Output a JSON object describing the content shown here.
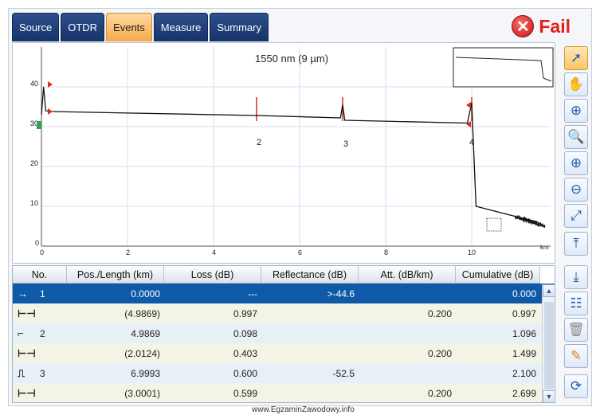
{
  "tabs": [
    {
      "label": "Source",
      "active": false
    },
    {
      "label": "OTDR",
      "active": false
    },
    {
      "label": "Events",
      "active": true
    },
    {
      "label": "Measure",
      "active": false
    },
    {
      "label": "Summary",
      "active": false
    }
  ],
  "status": {
    "label": "Fail",
    "color": "#e2211b"
  },
  "chart": {
    "wavelength_label": "1550 nm (9 µm)",
    "x_unit": "km",
    "y_ticks": [
      "40",
      "30",
      "20",
      "10",
      "0"
    ],
    "x_ticks": [
      "0",
      "2",
      "4",
      "6",
      "8",
      "10"
    ],
    "event_labels": [
      "2",
      "3",
      "4"
    ]
  },
  "chart_data": {
    "type": "line",
    "title": "1550 nm (9 µm)",
    "xlabel": "km",
    "ylabel": "",
    "xlim": [
      0,
      11.7
    ],
    "ylim": [
      0,
      50
    ],
    "grid": true,
    "series": [
      {
        "values": [
          [
            0,
            33
          ],
          [
            0.05,
            40
          ],
          [
            0.1,
            34
          ],
          [
            0.2,
            33.8
          ],
          [
            5.0,
            32.8
          ],
          [
            6.95,
            32.2
          ],
          [
            7.0,
            35.5
          ],
          [
            7.05,
            31.6
          ],
          [
            9.9,
            30.9
          ],
          [
            10.0,
            36
          ],
          [
            10.1,
            10
          ],
          [
            11.0,
            7.5
          ],
          [
            11.5,
            6.2
          ],
          [
            11.7,
            4.8
          ]
        ]
      }
    ],
    "events": [
      {
        "label": "2",
        "x": 5.0
      },
      {
        "label": "3",
        "x": 7.0
      },
      {
        "label": "4",
        "x": 10.0
      }
    ]
  },
  "tools": [
    "cursor-icon",
    "hand-icon",
    "zoom-area-icon",
    "zoom-1to1-icon",
    "zoom-in-icon",
    "zoom-out-icon",
    "zoom-fit-icon",
    "scroll-up-icon",
    "scroll-down-icon",
    "event-list-icon",
    "trash-icon",
    "pencil-icon",
    "refresh-icon"
  ],
  "table": {
    "headers": [
      "No.",
      "Pos./Length (km)",
      "Loss (dB)",
      "Reflectance (dB)",
      "Att. (dB/km)",
      "Cumulative (dB)"
    ],
    "rows": [
      {
        "icon": "→",
        "no": "1",
        "pos": "0.0000",
        "loss": "---",
        "refl": ">-44.6",
        "att": "",
        "cum": "0.000",
        "style": "sel"
      },
      {
        "icon": "⊢⊣",
        "no": "",
        "pos": "(4.9869)",
        "loss": "0.997",
        "refl": "",
        "att": "0.200",
        "cum": "0.997",
        "style": "alt"
      },
      {
        "icon": "⌐",
        "no": "2",
        "pos": "4.9869",
        "loss": "0.098",
        "refl": "",
        "att": "",
        "cum": "1.096",
        "style": "lt"
      },
      {
        "icon": "⊢⊣",
        "no": "",
        "pos": "(2.0124)",
        "loss": "0.403",
        "refl": "",
        "att": "0.200",
        "cum": "1.499",
        "style": "alt"
      },
      {
        "icon": "⎍",
        "no": "3",
        "pos": "6.9993",
        "loss": "0.600",
        "refl": "-52.5",
        "att": "",
        "cum": "2.100",
        "style": "lt"
      },
      {
        "icon": "⊢⊣",
        "no": "",
        "pos": "(3.0001)",
        "loss": "0.599",
        "refl": "",
        "att": "0.200",
        "cum": "2.699",
        "style": "alt"
      }
    ]
  },
  "watermark": "www.EgzaminZawodowy.info"
}
